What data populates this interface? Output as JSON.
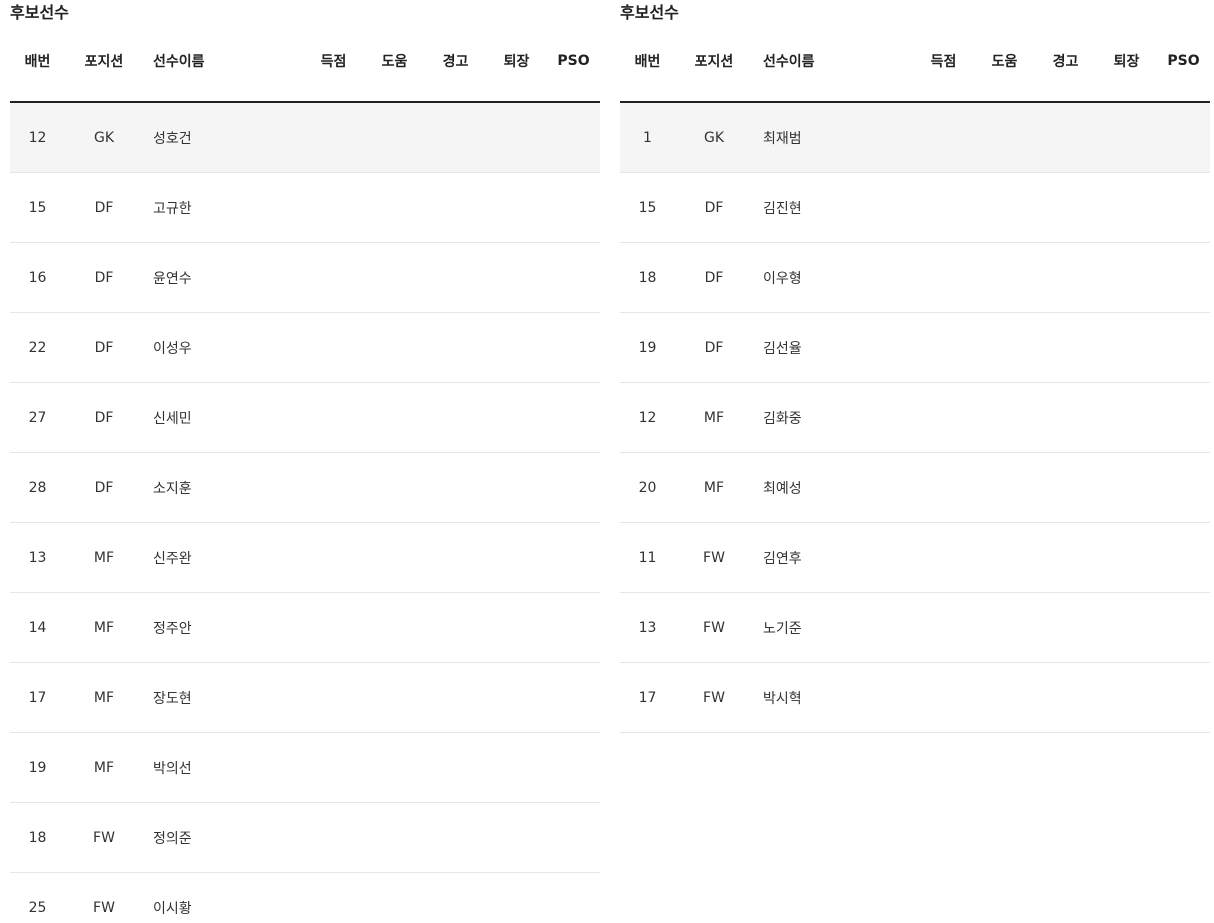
{
  "left": {
    "title": "후보선수",
    "headers": {
      "number": "배번",
      "position": "포지션",
      "name": "선수이름",
      "goals": "득점",
      "assists": "도움",
      "warnings": "경고",
      "sendoffs": "퇴장",
      "pso": "PSO"
    },
    "rows": [
      {
        "number": "12",
        "position": "GK",
        "name": "성호건"
      },
      {
        "number": "15",
        "position": "DF",
        "name": "고규한"
      },
      {
        "number": "16",
        "position": "DF",
        "name": "윤연수"
      },
      {
        "number": "22",
        "position": "DF",
        "name": "이성우"
      },
      {
        "number": "27",
        "position": "DF",
        "name": "신세민"
      },
      {
        "number": "28",
        "position": "DF",
        "name": "소지훈"
      },
      {
        "number": "13",
        "position": "MF",
        "name": "신주완"
      },
      {
        "number": "14",
        "position": "MF",
        "name": "정주안"
      },
      {
        "number": "17",
        "position": "MF",
        "name": "장도현"
      },
      {
        "number": "19",
        "position": "MF",
        "name": "박의선"
      },
      {
        "number": "18",
        "position": "FW",
        "name": "정의준"
      },
      {
        "number": "25",
        "position": "FW",
        "name": "이시황"
      }
    ]
  },
  "right": {
    "title": "후보선수",
    "headers": {
      "number": "배번",
      "position": "포지션",
      "name": "선수이름",
      "goals": "득점",
      "assists": "도움",
      "warnings": "경고",
      "sendoffs": "퇴장",
      "pso": "PSO"
    },
    "rows": [
      {
        "number": "1",
        "position": "GK",
        "name": "최재범"
      },
      {
        "number": "15",
        "position": "DF",
        "name": "김진현"
      },
      {
        "number": "18",
        "position": "DF",
        "name": "이우형"
      },
      {
        "number": "19",
        "position": "DF",
        "name": "김선율"
      },
      {
        "number": "12",
        "position": "MF",
        "name": "김화중"
      },
      {
        "number": "20",
        "position": "MF",
        "name": "최예성"
      },
      {
        "number": "11",
        "position": "FW",
        "name": "김연후"
      },
      {
        "number": "13",
        "position": "FW",
        "name": "노기준"
      },
      {
        "number": "17",
        "position": "FW",
        "name": "박시혁"
      }
    ]
  }
}
